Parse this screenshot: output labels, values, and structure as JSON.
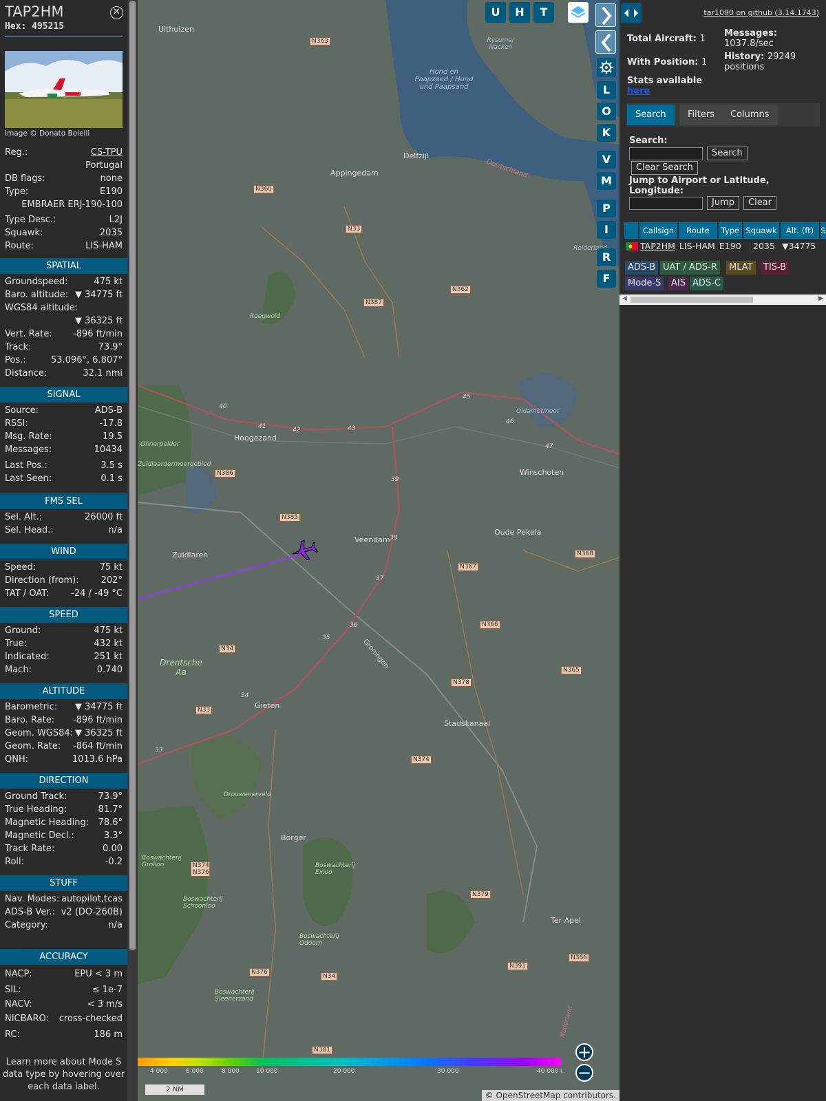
{
  "aircraft": {
    "callsign": "TAP2HM",
    "hex_label": "Hex:",
    "hex": "495215",
    "photo_credit": "Image © Donato Bolelli",
    "reg_label": "Reg.:",
    "reg": "CS-TPU",
    "country": "Portugal",
    "dbflags_label": "DB flags:",
    "dbflags": "none",
    "type_label": "Type:",
    "type": "E190",
    "type_full": "EMBRAER ERJ-190-100",
    "typedesc_label": "Type Desc.:",
    "typedesc": "L2J",
    "squawk_label": "Squawk:",
    "squawk": "2035",
    "route_label": "Route:",
    "route": "LIS-HAM"
  },
  "sections": {
    "spatial": "SPATIAL",
    "signal": "SIGNAL",
    "fms": "FMS SEL",
    "wind": "WIND",
    "speed": "SPEED",
    "altitude": "ALTITUDE",
    "direction": "DIRECTION",
    "stuff": "STUFF",
    "accuracy": "ACCURACY"
  },
  "spatial": [
    {
      "label": "Groundspeed:",
      "value": "475 kt"
    },
    {
      "label": "Baro. altitude:",
      "value": "▼ 34775 ft"
    },
    {
      "label": "WGS84 altitude:",
      "value": ""
    },
    {
      "label": "",
      "value": "▼ 36325 ft"
    },
    {
      "label": "Vert. Rate:",
      "value": "-896 ft/min"
    },
    {
      "label": "Track:",
      "value": "73.9°"
    },
    {
      "label": "Pos.:",
      "value": "53.096°, 6.807°"
    },
    {
      "label": "Distance:",
      "value": "32.1 nmi"
    }
  ],
  "signal": [
    {
      "label": "Source:",
      "value": "ADS-B"
    },
    {
      "label": "RSSI:",
      "value": "-17.8"
    },
    {
      "label": "Msg. Rate:",
      "value": "19.5"
    },
    {
      "label": "Messages:",
      "value": "10434"
    },
    {
      "label": "Last Pos.:",
      "value": "3.5 s"
    },
    {
      "label": "Last Seen:",
      "value": "0.1 s"
    }
  ],
  "fms": [
    {
      "label": "Sel. Alt.:",
      "value": "26000 ft"
    },
    {
      "label": "Sel. Head.:",
      "value": "n/a"
    }
  ],
  "wind": [
    {
      "label": "Speed:",
      "value": "75 kt"
    },
    {
      "label": "Direction (from):",
      "value": "202°"
    },
    {
      "label": "TAT / OAT:",
      "value": "-24 / -49 °C"
    }
  ],
  "speed": [
    {
      "label": "Ground:",
      "value": "475 kt"
    },
    {
      "label": "True:",
      "value": "432 kt"
    },
    {
      "label": "Indicated:",
      "value": "251 kt"
    },
    {
      "label": "Mach:",
      "value": "0.740"
    }
  ],
  "altitude": [
    {
      "label": "Barometric:",
      "value": "▼ 34775 ft"
    },
    {
      "label": "Baro. Rate:",
      "value": "-896 ft/min"
    },
    {
      "label": "Geom. WGS84:",
      "value": "▼ 36325 ft"
    },
    {
      "label": "Geom. Rate:",
      "value": "-864 ft/min"
    },
    {
      "label": "QNH:",
      "value": "1013.6 hPa"
    }
  ],
  "direction": [
    {
      "label": "Ground Track:",
      "value": "73.9°"
    },
    {
      "label": "True Heading:",
      "value": "81.7°"
    },
    {
      "label": "Magnetic Heading:",
      "value": "78.6°"
    },
    {
      "label": "Magnetic Decl.:",
      "value": "3.3°"
    },
    {
      "label": "Track Rate:",
      "value": "0.00"
    },
    {
      "label": "Roll:",
      "value": "-0.2"
    }
  ],
  "stuff": [
    {
      "label": "Nav. Modes:",
      "value": "autopilot,tcas"
    },
    {
      "label": "ADS-B Ver.:",
      "value": "v2 (DO-260B)"
    },
    {
      "label": "Category:",
      "value": "n/a"
    }
  ],
  "accuracy": [
    {
      "label": "NACP:",
      "value": "EPU < 3 m"
    },
    {
      "label": "SIL:",
      "value": "≤ 1e-7"
    },
    {
      "label": "NACV:",
      "value": "< 3 m/s"
    },
    {
      "label": "NICBARO:",
      "value": "cross-checked"
    },
    {
      "label": "RC:",
      "value": "186 m"
    }
  ],
  "info_footer": "Learn more about Mode S data type by hovering over each data label.",
  "map": {
    "buttons_top": [
      "U",
      "H",
      "T"
    ],
    "side_buttons": [
      "L",
      "O",
      "K",
      "V",
      "M",
      "P",
      "I",
      "R",
      "F"
    ],
    "places": [
      "Uithuizen",
      "Appingedam",
      "Delfzijl",
      "Hoogezand",
      "Winschoten",
      "Zuidlaren",
      "Veendam",
      "Oude Pekela",
      "Gieten",
      "Stadskanaal",
      "Borger",
      "Ter Apel",
      "Drentsche Aa",
      "Hond en Paapzand / Hund und Paapsand",
      "Rysumer Nacken",
      "Deutschland",
      "Oldambtmeer",
      "Drouwenerveld",
      "Onnerpolder",
      "Zuidlaardermeergebied",
      "Roegwold",
      "Groningen",
      "Boswachterij Grolloo",
      "Boswachterij Exloo",
      "Boswachterij Schoonloo",
      "Boswachterij Odoorn",
      "Boswachterij Sleenerzand",
      "Reiderland",
      "Nederland"
    ],
    "roads": [
      "N363",
      "N360",
      "N33",
      "N387",
      "N362",
      "N386",
      "N385",
      "N367",
      "N368",
      "N366",
      "N34",
      "N378",
      "N365",
      "N33",
      "N374",
      "N374 N376",
      "N379",
      "N376",
      "N34",
      "N391",
      "N366",
      "N381"
    ],
    "km_markers": [
      "40",
      "41",
      "42",
      "43",
      "45",
      "46",
      "47",
      "39",
      "38",
      "37",
      "36",
      "35",
      "34",
      "33"
    ],
    "color_scale": [
      "4 000",
      "6 000",
      "8 000",
      "10 000",
      "20 000",
      "30 000",
      "40 000+"
    ],
    "scale": "2 NM",
    "attribution_prefix": "© ",
    "attribution_link": "OpenStreetMap",
    "attribution_suffix": " contributors.",
    "track_color": "#9b30ff"
  },
  "right": {
    "github": "tar1090 on github (3.14.1743)",
    "total_label": "Total Aircraft:",
    "total": "1",
    "withpos_label": "With Position:",
    "withpos": "1",
    "messages_label": "Messages:",
    "messages": "1037.8/sec",
    "history_label": "History:",
    "history": "29249 positions",
    "stats_label": "Stats available",
    "stats_link": "here",
    "tabs": [
      "Search",
      "Filters",
      "Columns"
    ],
    "search_label": "Search:",
    "search_button": "Search",
    "clear_search_button": "Clear Search",
    "jump_label": "Jump to Airport or Latitude, Longitude:",
    "jump_button": "Jump",
    "clear_button": "Clear",
    "table_headers": [
      "Callsign",
      "Route",
      "Type",
      "Squawk",
      "Alt. (ft)",
      "S"
    ],
    "table_row": {
      "callsign": "TAP2HM",
      "route": "LIS-HAM",
      "type": "E190",
      "squawk": "2035",
      "alt": "▼34775"
    },
    "badges": [
      "ADS-B",
      "UAT / ADS-R",
      "MLAT",
      "TIS-B",
      "Mode-S",
      "AIS",
      "ADS-C"
    ]
  },
  "colors": {
    "accent": "#005a80",
    "header": "#006d98"
  }
}
